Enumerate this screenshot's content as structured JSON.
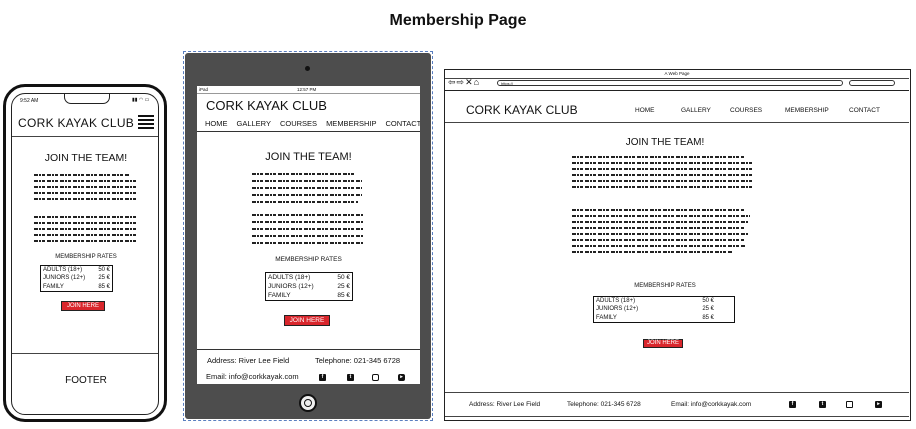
{
  "title": "Membership Page",
  "site": {
    "name": "CORK KAYAK CLUB",
    "nav": [
      "HOME",
      "GALLERY",
      "COURSES",
      "MEMBERSHIP",
      "CONTACT"
    ],
    "join_heading": "JOIN THE TEAM!",
    "rates_heading": "MEMBERSHIP RATES",
    "rates": [
      {
        "label": "ADULTS (18+)",
        "price": "50 €"
      },
      {
        "label": "JUNIORS (12+)",
        "price": "25 €"
      },
      {
        "label": "FAMILY",
        "price": "85 €"
      }
    ],
    "join_button": "JOIN HERE",
    "address": "Address: River Lee Field",
    "telephone": "Telephone: 021-345 6728",
    "email": "Email: info@corkkayak.com",
    "footer_placeholder": "FOOTER",
    "social_icons": [
      "facebook-icon",
      "twitter-icon",
      "instagram-icon",
      "youtube-icon"
    ]
  },
  "phone": {
    "time": "9:52 AM"
  },
  "tablet": {
    "device": "iPad",
    "time": "12:57 PM"
  },
  "desktop": {
    "window_title": "A Web Page",
    "url": "https://"
  },
  "colors": {
    "button": "#d9262c",
    "tablet_frame": "#4d4d4d"
  }
}
